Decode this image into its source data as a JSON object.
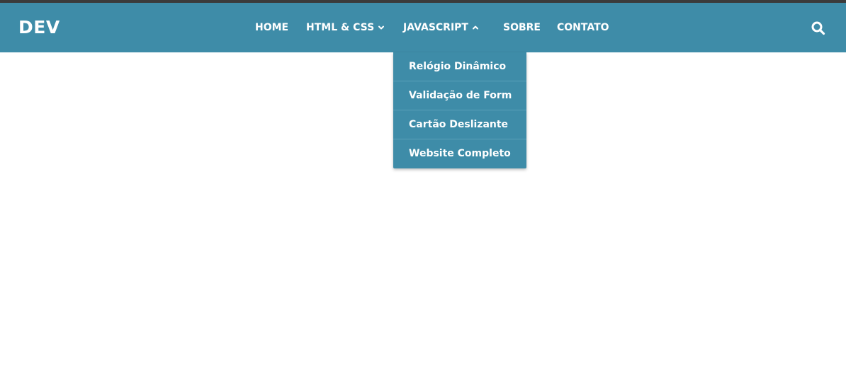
{
  "header": {
    "logo": "DEV",
    "nav": {
      "home": "HOME",
      "html_css": "HTML & CSS",
      "javascript": "JAVASCRIPT",
      "sobre": "SOBRE",
      "contato": "CONTATO"
    },
    "search_icon": "search-icon"
  },
  "dropdown": {
    "items": [
      "Relógio Dinâmico",
      "Validação de Form",
      "Cartão Deslizante",
      "Website Completo"
    ]
  },
  "colors": {
    "navbar": "#3e8ca8",
    "top_strip": "#3b3b3b",
    "text": "#ffffff"
  }
}
